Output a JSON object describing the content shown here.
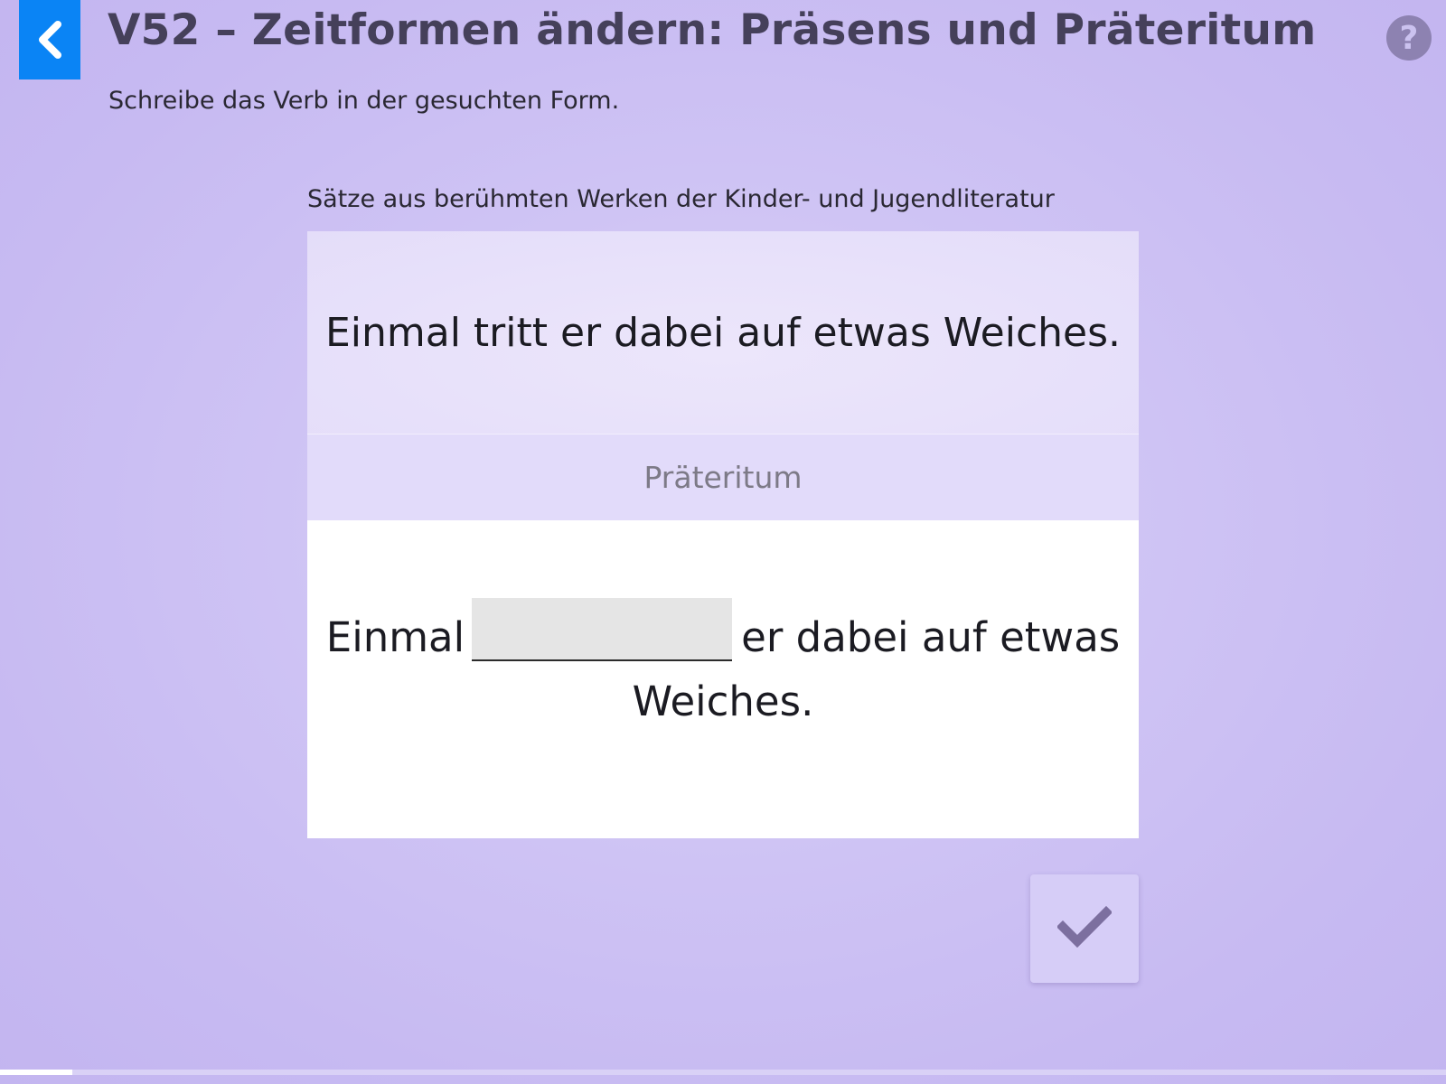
{
  "header": {
    "title": "V52 – Zeitformen ändern: Präsens und Präteritum",
    "instruction": "Schreibe das Verb in der gesuchten Form.",
    "back_icon": "chevron-left-icon",
    "help_icon": "question-mark-icon",
    "help_label": "?"
  },
  "exercise": {
    "source_label": "Sätze aus berühmten Werken der Kinder- und Jugendliteratur",
    "prompt_sentence": "Einmal tritt er dabei auf etwas Weiches.",
    "target_tense": "Präteritum",
    "answer_before": "Einmal",
    "answer_value": "",
    "answer_after": "er dabei auf etwas",
    "answer_after_line2": "Weiches."
  },
  "actions": {
    "check_icon": "checkmark-icon"
  },
  "progress": {
    "fraction": 0.05
  },
  "colors": {
    "accent_blue": "#0a84f5",
    "background": "#c7baf2",
    "title_text": "#45405a",
    "check_icon": "#7c6f9f"
  }
}
